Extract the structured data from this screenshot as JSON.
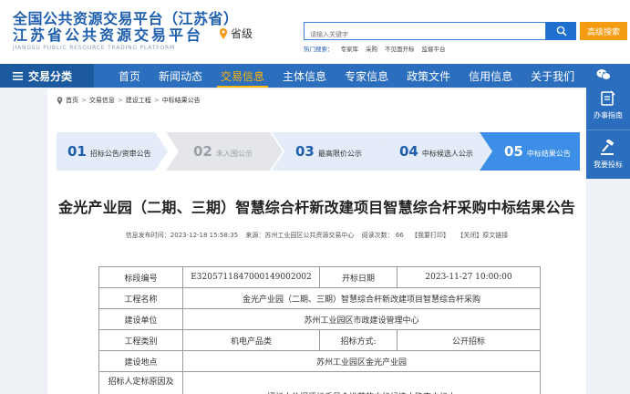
{
  "header": {
    "logo_line1": "全国公共资源交易平台（江苏省）",
    "logo_line2": "江苏省公共资源交易平台",
    "logo_line3": "JIANGSU PUBLIC RESOURCE TRADING PLATFORM",
    "province": "省级",
    "search_placeholder": "请输入关键字",
    "adv_search": "高级搜索",
    "hot_label": "热门搜索：",
    "hot_terms": [
      "专家库",
      "采购",
      "不见面开标",
      "监督平台"
    ]
  },
  "nav": {
    "category": "交易分类",
    "items": [
      "首页",
      "新闻动态",
      "交易信息",
      "主体信息",
      "专家信息",
      "政策文件",
      "信用信息",
      "关于我们"
    ],
    "active_index": 2
  },
  "side": {
    "guide": "办事指南",
    "complaint": "我要投标"
  },
  "breadcrumb": [
    "首页",
    "交易信息",
    "建设工程",
    "中标结果公告"
  ],
  "steps": [
    {
      "num": "01",
      "label": "招标公告/资审公告",
      "state": "normal"
    },
    {
      "num": "02",
      "label": "未入围公示",
      "state": "disabled"
    },
    {
      "num": "03",
      "label": "最高限价公示",
      "state": "normal"
    },
    {
      "num": "04",
      "label": "中标候选人公示",
      "state": "normal"
    },
    {
      "num": "05",
      "label": "中标结果公告",
      "state": "active"
    }
  ],
  "article": {
    "title": "金光产业园（二期、三期）智慧综合杆新改建项目智慧综合杆采购中标结果公告",
    "publish_time": "信息发布时间：2023-12-18 15:58:35",
    "source": "来源：苏州工业园区公共资源交易中心",
    "views": "阅读次数：  66",
    "print": "【我要打印】",
    "close": "【关闭】",
    "origin_link": "原文链接"
  },
  "table": {
    "section_no_label": "标段编号",
    "section_no": "E3205711847000149002002",
    "open_date_label": "开标日期",
    "open_date": "2023-11-27  10:00:00",
    "project_name_label": "工程名称",
    "project_name": "金光产业园（二期、三期）智慧综合杆新改建项目智慧综合杆采购",
    "builder_label": "建设单位",
    "builder": "苏州工业园区市政建设管理中心",
    "type_label": "工程类别",
    "type": "机电产品类",
    "method_label": "招标方式:",
    "method": "公开招标",
    "location_label": "建设地点",
    "location": "苏州工业园区金光产业园",
    "basis_label": "招标人定标原因及",
    "basis": "招标人依据评标委员会推荐的中标候选人确定中标人"
  },
  "colors": {
    "brand_blue": "#2a6ebd",
    "accent_orange": "#f39c12",
    "active_nav": "#ffb400"
  }
}
